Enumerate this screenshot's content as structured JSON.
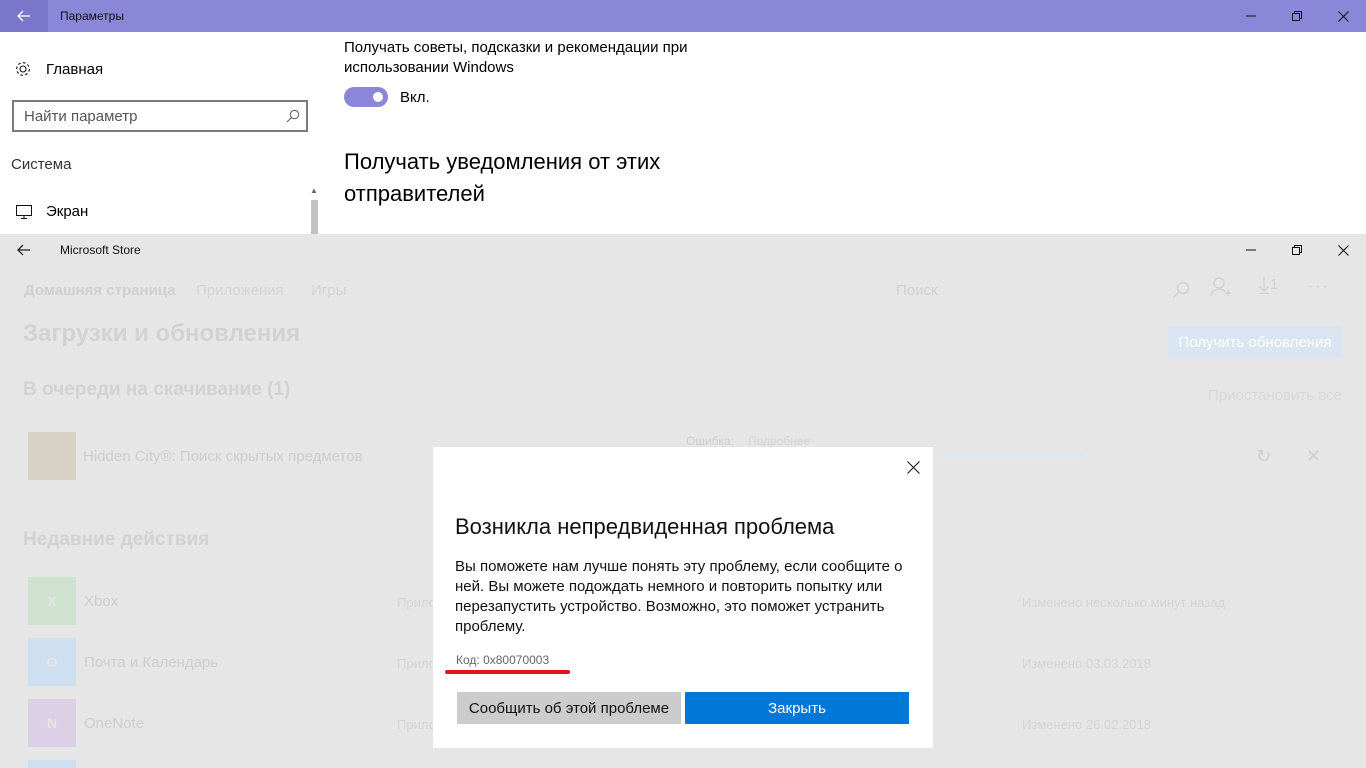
{
  "settings": {
    "window_title": "Параметры",
    "home_label": "Главная",
    "search_placeholder": "Найти параметр",
    "section_label": "Система",
    "screen_item_label": "Экран",
    "tips_text": "Получать советы, подсказки и рекомендации при использовании Windows",
    "toggle_label": "Вкл.",
    "toggle_on": true,
    "notifications_heading": "Получать уведомления от этих отправителей",
    "accent_color": "#8b87d8"
  },
  "store": {
    "window_title": "Microsoft Store",
    "nav": [
      "Домашняя страница",
      "Приложения",
      "Игры"
    ],
    "search_placeholder": "Поиск",
    "downloads_count": "1",
    "page_title": "Загрузки и обновления",
    "get_updates_label": "Получить обновления",
    "queue_heading": "В очереди на скачивание (1)",
    "pause_all_label": "Приостановить все",
    "queue_item": {
      "name": "Hidden City®: Поиск скрытых предметов",
      "error_label": "Ошибка:",
      "details_label": "Подробнее"
    },
    "recent_heading": "Недавние действия",
    "recent": [
      {
        "name": "Xbox",
        "kind": "Прило",
        "date": "Изменено несколько минут назад",
        "icon": "xbox-icon",
        "color": "#cfe2cf",
        "glyph": "X"
      },
      {
        "name": "Почта и Календарь",
        "kind": "Прило",
        "date": "Изменено 03.03.2018",
        "icon": "mail-icon",
        "color": "#cddff0",
        "glyph": "O"
      },
      {
        "name": "OneNote",
        "kind": "Прило",
        "date": "Изменено 26.02.2018",
        "icon": "onenote-icon",
        "color": "#dcd0e6",
        "glyph": "N"
      }
    ]
  },
  "dialog": {
    "title": "Возникла непредвиденная проблема",
    "body": "Вы поможете нам лучше понять эту проблему, если сообщите о ней. Вы можете подождать немного и повторить попытку или перезапустить устройство. Возможно, это поможет устранить проблему.",
    "code": "Код: 0x80070003",
    "report_label": "Сообщить об этой проблеме",
    "close_label": "Закрыть",
    "primary_color": "#0078d7",
    "highlight_color": "#e2111c"
  }
}
